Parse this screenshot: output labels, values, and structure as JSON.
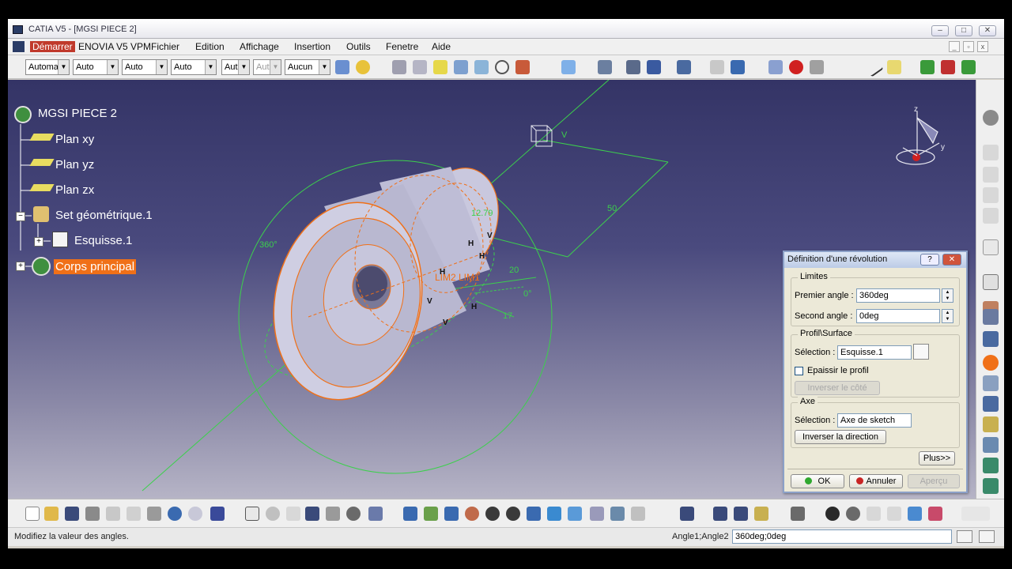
{
  "window": {
    "title": "CATIA V5 - [MGSI PIECE 2]",
    "controls": [
      "–",
      "□",
      "✕"
    ]
  },
  "menu": {
    "items": [
      "Démarrer",
      "ENOVIA V5 VPM",
      "Fichier",
      "Edition",
      "Affichage",
      "Insertion",
      "Outils",
      "Fenetre",
      "Aide"
    ]
  },
  "toolbar": {
    "combos": [
      "Automa",
      "Auto",
      "Auto",
      "Auto",
      "Aut",
      "Aut",
      "Aucun"
    ]
  },
  "tree": {
    "root": "MGSI PIECE 2",
    "items": [
      {
        "label": "Plan xy"
      },
      {
        "label": "Plan yz"
      },
      {
        "label": "Plan zx"
      },
      {
        "label": "Set géométrique.1"
      },
      {
        "label": "Esquisse.1"
      },
      {
        "label": "Corps principal"
      }
    ]
  },
  "viewport": {
    "annotations": {
      "angle_360": "360°",
      "dim_50": "50",
      "dim_20": "20",
      "dim_17": "17",
      "angle_0": "0°",
      "dim_1279": "12.79",
      "lim_labels": "LIM2 LIM1",
      "axis_v": "V",
      "compass_z": "z",
      "compass_y": "y"
    }
  },
  "dialog": {
    "title": "Définition d'une révolution",
    "limits": {
      "legend": "Limites",
      "first_label": "Premier angle :",
      "first_value": "360deg",
      "second_label": "Second angle :",
      "second_value": "0deg"
    },
    "profile": {
      "legend": "Profil\\Surface",
      "selection_label": "Sélection :",
      "selection_value": "Esquisse.1",
      "thicken_label": "Epaissir le profil",
      "reverse_side_label": "Inverser le côté"
    },
    "axis": {
      "legend": "Axe",
      "selection_label": "Sélection :",
      "selection_value": "Axe de sketch",
      "reverse_direction_label": "Inverser la direction"
    },
    "more_label": "Plus>>",
    "ok_label": "OK",
    "cancel_label": "Annuler",
    "apply_label": "Aperçu"
  },
  "status": {
    "message": "Modifiez la valeur des angles.",
    "field_label": "Angle1;Angle2",
    "field_value": "360deg;0deg"
  },
  "colors": {
    "viewport_top": "#343466",
    "viewport_bottom": "#b6b4c6",
    "selection_orange": "#f07018",
    "construction_green": "#33cc44",
    "part_fill": "#c7c6dc"
  }
}
